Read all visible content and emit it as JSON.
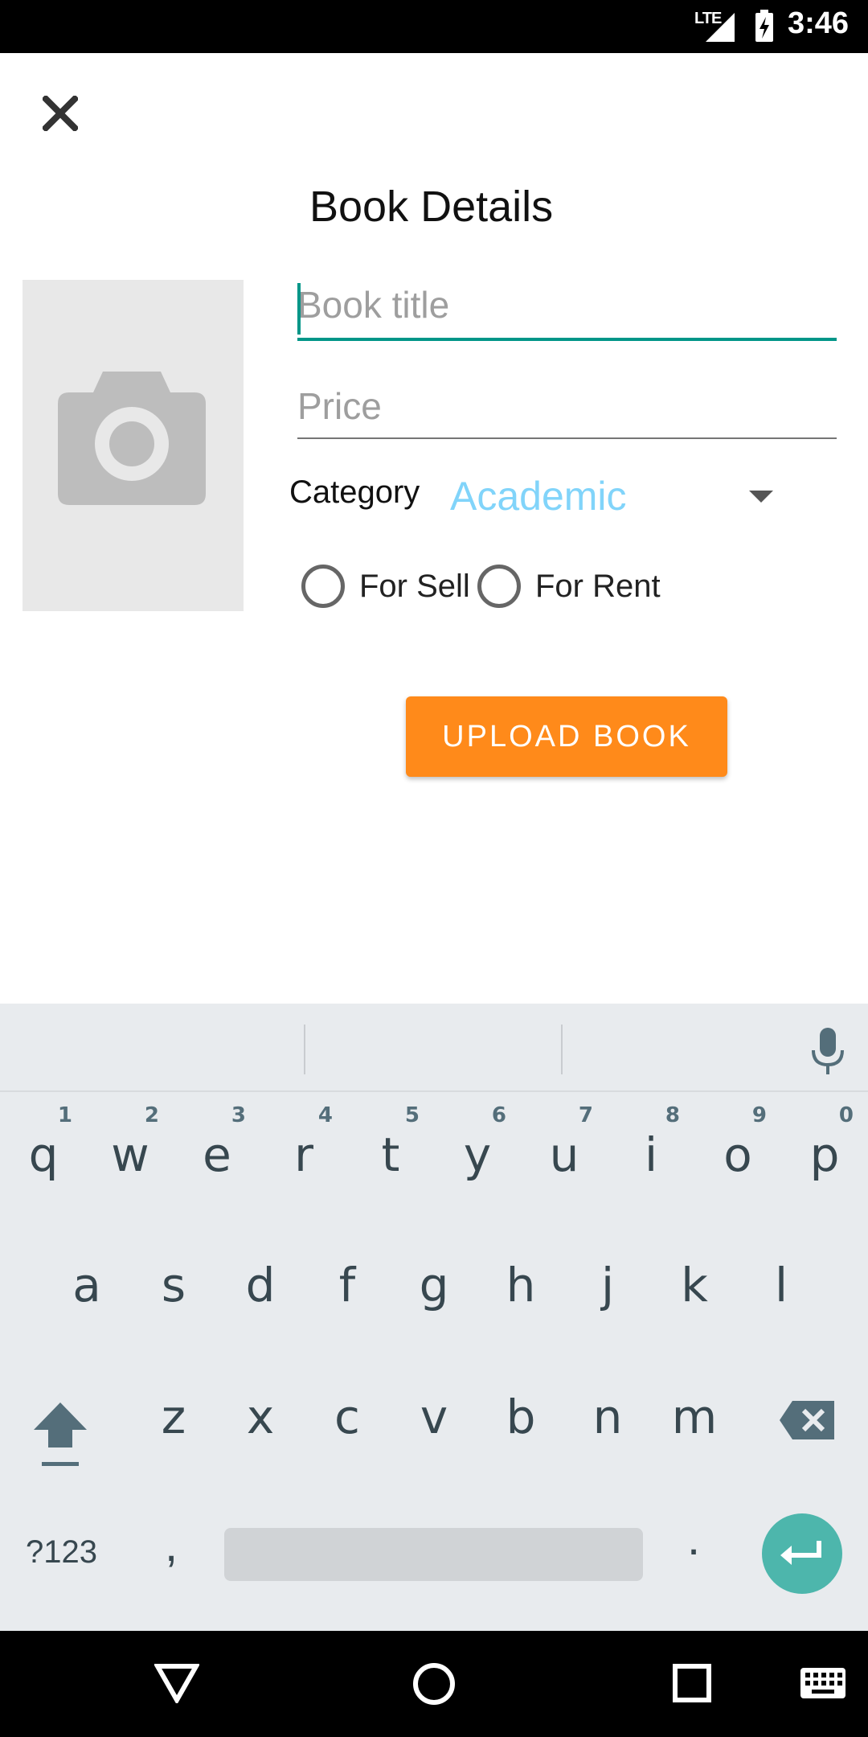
{
  "status_bar": {
    "network": "LTE",
    "time": "3:46"
  },
  "header": {
    "close_icon": "close-icon",
    "title": "Book Details"
  },
  "form": {
    "photo_placeholder_icon": "camera-icon",
    "title_placeholder": "Book title",
    "price_placeholder": "Price",
    "category_label": "Category",
    "category_value": "Academic",
    "radio_options": [
      "For Sell",
      "For Rent"
    ],
    "upload_button": "UPLOAD BOOK"
  },
  "keyboard": {
    "row1": [
      {
        "c": "q",
        "h": "1"
      },
      {
        "c": "w",
        "h": "2"
      },
      {
        "c": "e",
        "h": "3"
      },
      {
        "c": "r",
        "h": "4"
      },
      {
        "c": "t",
        "h": "5"
      },
      {
        "c": "y",
        "h": "6"
      },
      {
        "c": "u",
        "h": "7"
      },
      {
        "c": "i",
        "h": "8"
      },
      {
        "c": "o",
        "h": "9"
      },
      {
        "c": "p",
        "h": "0"
      }
    ],
    "row2": [
      "a",
      "s",
      "d",
      "f",
      "g",
      "h",
      "j",
      "k",
      "l"
    ],
    "row3": [
      "z",
      "x",
      "c",
      "v",
      "b",
      "n",
      "m"
    ],
    "symbols_key": "?123",
    "comma_key": ",",
    "period_key": "."
  },
  "colors": {
    "accent_teal": "#009688",
    "category_text": "#81d4fa",
    "upload_button": "#ff8a1a",
    "enter_key": "#4db6ac"
  }
}
